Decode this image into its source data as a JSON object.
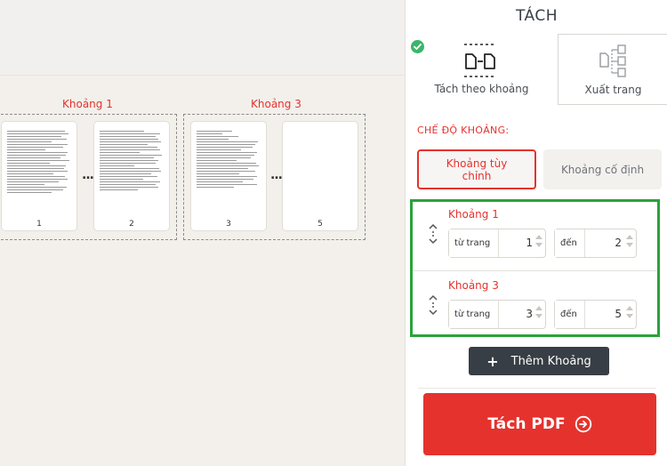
{
  "sidebar": {
    "title": "TÁCH",
    "tabs": [
      {
        "label": "Tách theo khoảng",
        "icon": "split-range-icon",
        "active": true
      },
      {
        "label": "Xuất trang",
        "icon": "extract-pages-icon",
        "active": false
      }
    ],
    "mode_label": "CHẾ ĐỘ KHOẢNG:",
    "modes": [
      {
        "label": "Khoảng tùy chỉnh",
        "active": true
      },
      {
        "label": "Khoảng cố định",
        "active": false
      }
    ],
    "ranges": [
      {
        "title": "Khoảng 1",
        "from_label": "từ trang",
        "from": "1",
        "to_label": "đến",
        "to": "2"
      },
      {
        "title": "Khoảng 3",
        "from_label": "từ trang",
        "from": "3",
        "to_label": "đến",
        "to": "5"
      }
    ],
    "add_button": "Thêm Khoảng",
    "submit_button": "Tách PDF"
  },
  "preview": {
    "ranges": [
      {
        "label": "Khoảng 1",
        "pages": [
          "1",
          "2"
        ]
      },
      {
        "label": "Khoảng 3",
        "pages": [
          "3",
          "5"
        ]
      }
    ],
    "ellipsis": "..."
  },
  "colors": {
    "accent": "#e5322d",
    "highlight": "#2aa33a",
    "dark": "#383e45"
  }
}
